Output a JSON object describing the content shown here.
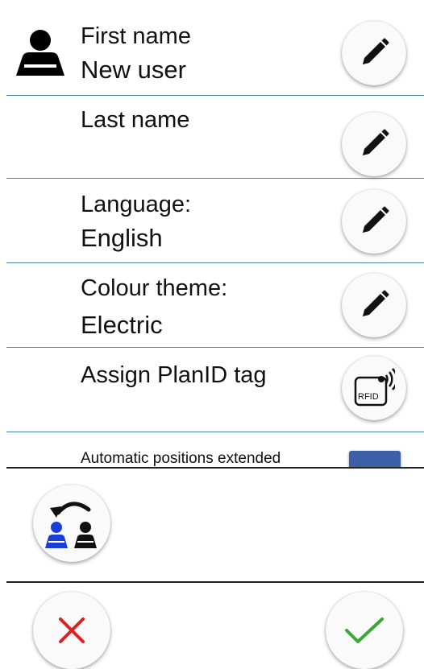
{
  "rows": {
    "first_name": {
      "label": "First name",
      "value": "New user"
    },
    "last_name": {
      "label": "Last name",
      "value": ""
    },
    "language": {
      "label": "Language:",
      "value": "English"
    },
    "colour_theme": {
      "label": "Colour theme:",
      "value": "Electric"
    },
    "planid": {
      "label": "Assign PlanID tag",
      "icon_text": "RFID"
    },
    "auto_positions": {
      "label": "Automatic positions extended"
    }
  },
  "icons": {
    "user": "user-icon",
    "edit": "pencil-icon",
    "rfid": "rfid-icon",
    "switch_user": "switch-user-icon",
    "cancel": "close-icon",
    "confirm": "check-icon"
  },
  "colors": {
    "separator": "#4a8ab0",
    "cancel": "#e02020",
    "confirm": "#3aa832",
    "user_blue": "#1b3fd6",
    "toggle_blue": "#3d5fa8"
  }
}
